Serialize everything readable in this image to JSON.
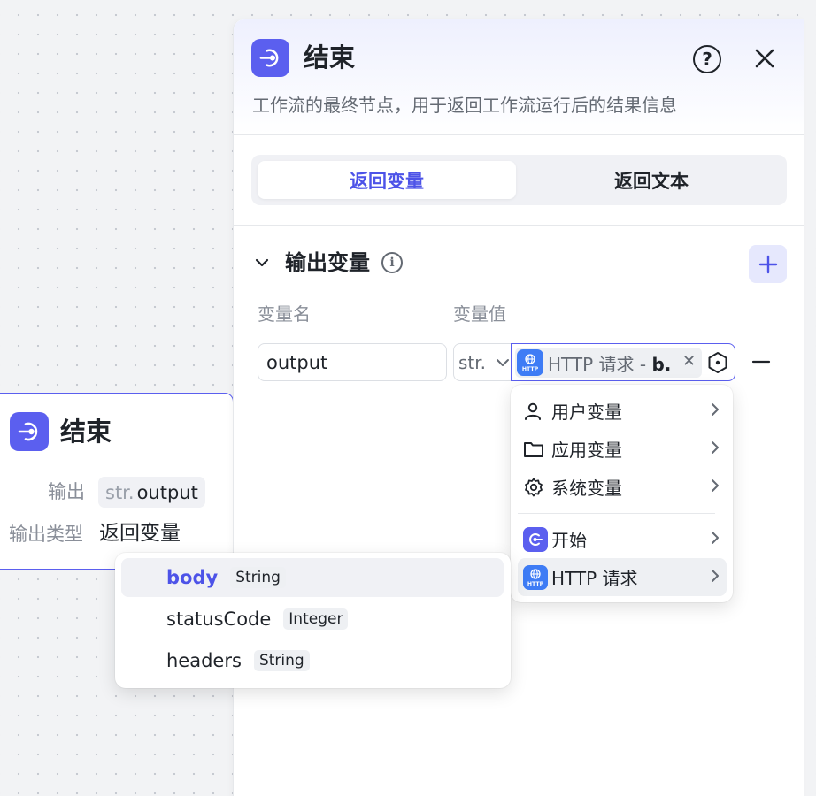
{
  "node": {
    "title": "结束",
    "output_label": "输出",
    "output_tag_prefix": "str.",
    "output_tag_name": "output",
    "output_type_label": "输出类型",
    "output_type_value": "返回变量"
  },
  "panel": {
    "title": "结束",
    "description": "工作流的最终节点，用于返回工作流运行后的结果信息",
    "tabs": [
      {
        "label": "返回变量",
        "active": true
      },
      {
        "label": "返回文本",
        "active": false
      }
    ],
    "section_title": "输出变量",
    "col_name_label": "变量名",
    "col_value_label": "变量值",
    "row": {
      "name_value": "output",
      "type_short": "str.",
      "ref_source": "HTTP 请求 - ",
      "ref_field": "b."
    }
  },
  "source_menu": {
    "items": [
      {
        "label": "用户变量",
        "icon": "user-icon"
      },
      {
        "label": "应用变量",
        "icon": "folder-icon"
      },
      {
        "label": "系统变量",
        "icon": "gear-icon"
      },
      {
        "label": "开始",
        "icon": "start-node-icon"
      },
      {
        "label": "HTTP 请求",
        "icon": "http-node-icon"
      }
    ]
  },
  "field_menu": {
    "items": [
      {
        "name": "body",
        "type": "String"
      },
      {
        "name": "statusCode",
        "type": "Integer"
      },
      {
        "name": "headers",
        "type": "String"
      }
    ]
  },
  "colors": {
    "accent": "#5b5fef",
    "accent_text": "#4d53e8",
    "http_blue": "#3e7cf5"
  }
}
